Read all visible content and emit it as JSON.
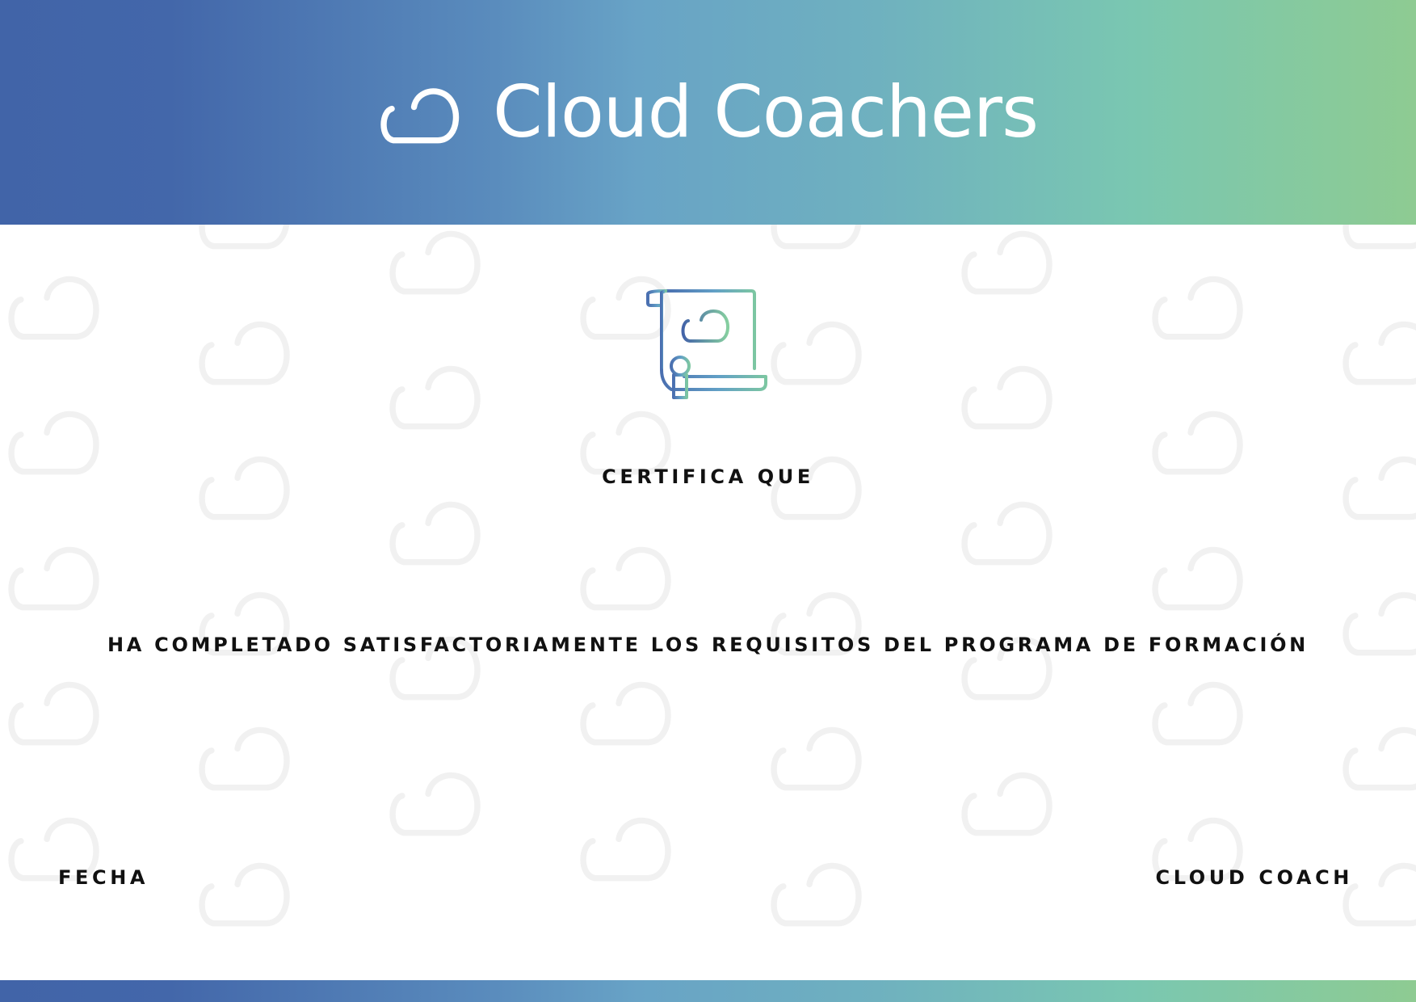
{
  "brand": {
    "name": "Cloud Coachers",
    "logo_icon": "cloud-icon"
  },
  "certificate": {
    "badge_icon": "certificate-scroll-icon",
    "certifies_label": "CERTIFICA QUE",
    "completion_statement": "HA COMPLETADO SATISFACTORIAMENTE LOS REQUISITOS DEL PROGRAMA DE FORMACIÓN",
    "date_label": "FECHA",
    "signatory_label": "CLOUD COACH"
  },
  "colors": {
    "gradient_start": "#4164a8",
    "gradient_mid": "#68a3c6",
    "gradient_end": "#8ecb92",
    "text": "#111111",
    "watermark": "#f1f1f1"
  }
}
